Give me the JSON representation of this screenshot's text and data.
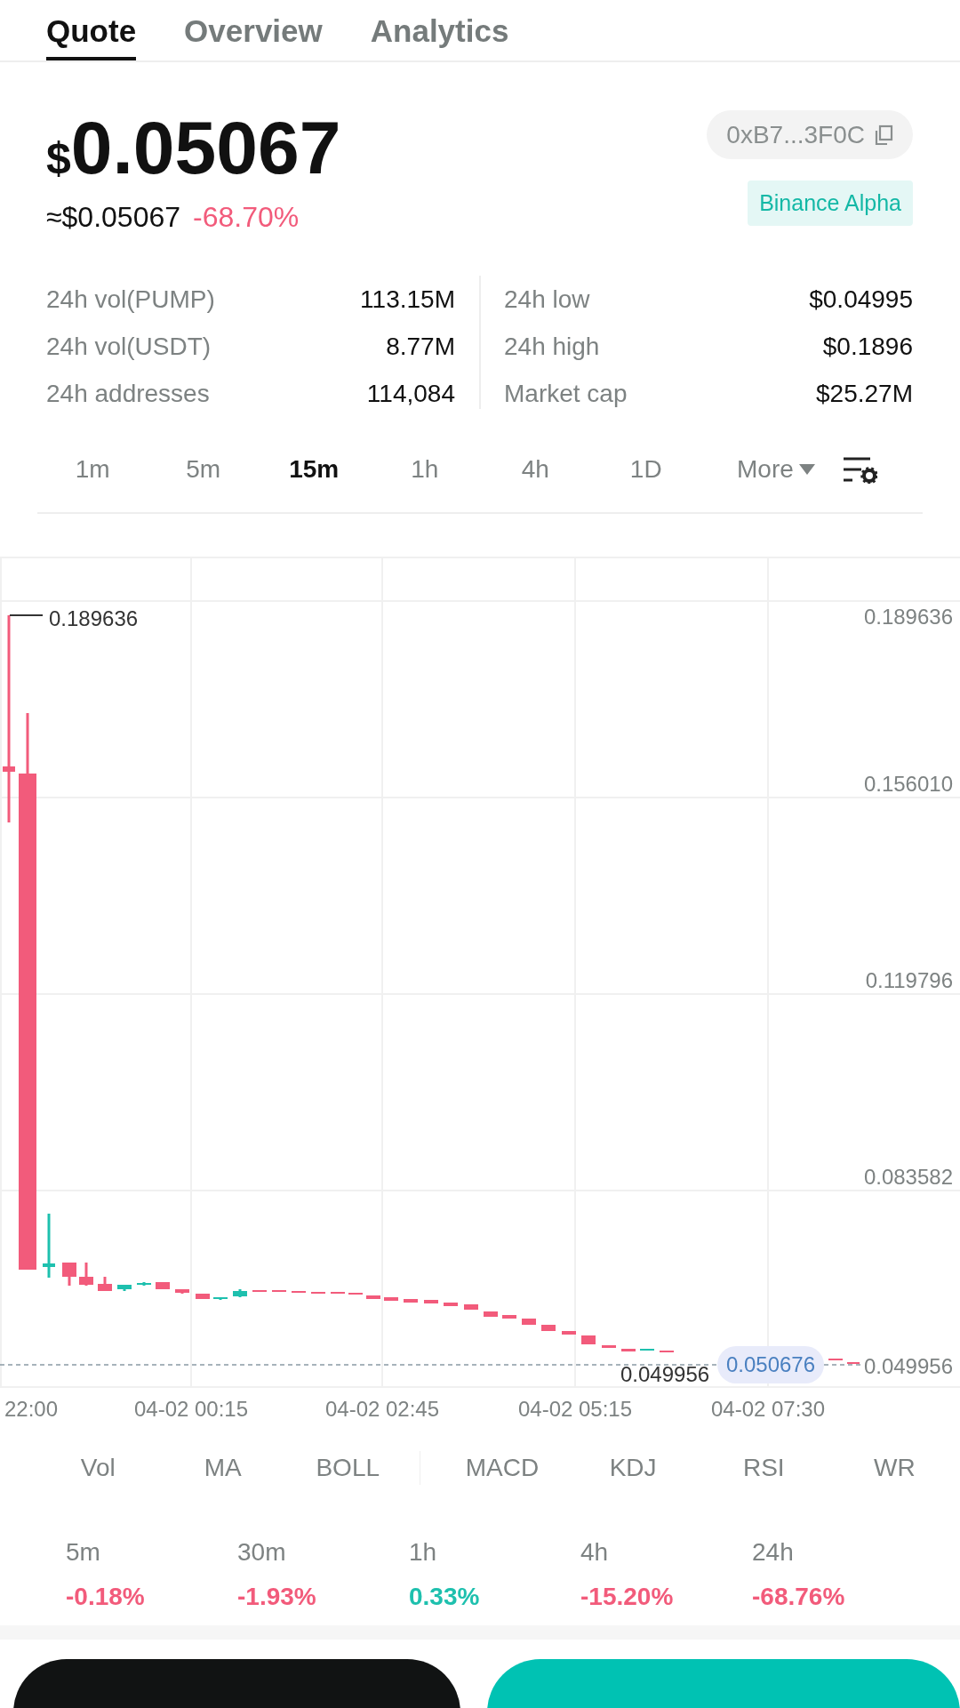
{
  "tabs": [
    {
      "label": "Quote",
      "selected": true
    },
    {
      "label": "Overview",
      "selected": false
    },
    {
      "label": "Analytics",
      "selected": false
    }
  ],
  "price": {
    "currency": "$",
    "value": "0.05067",
    "approx": "≈$0.05067",
    "change": "-68.70%",
    "color": "#f25b7b"
  },
  "contract": {
    "address": "0xB7...3F0C"
  },
  "badge": "Binance Alpha",
  "stats_left": [
    {
      "label": "24h vol(PUMP)",
      "value": "113.15M"
    },
    {
      "label": "24h vol(USDT)",
      "value": "8.77M"
    },
    {
      "label": "24h addresses",
      "value": "114,084"
    }
  ],
  "stats_right": [
    {
      "label": "24h low",
      "value": "$0.04995"
    },
    {
      "label": "24h high",
      "value": "$0.1896"
    },
    {
      "label": "Market cap",
      "value": "$25.27M"
    }
  ],
  "intervals": [
    {
      "label": "1m",
      "selected": false
    },
    {
      "label": "5m",
      "selected": false
    },
    {
      "label": "15m",
      "selected": true
    },
    {
      "label": "1h",
      "selected": false
    },
    {
      "label": "4h",
      "selected": false
    },
    {
      "label": "1D",
      "selected": false
    }
  ],
  "more": "More",
  "chart": {
    "y_labels": [
      "0.189636",
      "0.156010",
      "0.119796",
      "0.083582",
      "0.049956"
    ],
    "time_labels": [
      "22:00",
      "04-02 00:15",
      "04-02 02:45",
      "04-02 05:15",
      "04-02 07:30"
    ],
    "high_label": "0.189636",
    "low_label": "0.049956",
    "current_price": "0.050676"
  },
  "indicators_main": [
    "Vol",
    "MA",
    "BOLL"
  ],
  "indicators_sub": [
    "MACD",
    "KDJ",
    "RSI",
    "WR"
  ],
  "changes": [
    {
      "period": "5m",
      "value": "-0.18%",
      "color": "#f25b7b"
    },
    {
      "period": "30m",
      "value": "-1.93%",
      "color": "#f25b7b"
    },
    {
      "period": "1h",
      "value": "0.33%",
      "color": "#1ec0ae"
    },
    {
      "period": "4h",
      "value": "-15.20%",
      "color": "#f25b7b"
    },
    {
      "period": "24h",
      "value": "-68.76%",
      "color": "#f25b7b"
    }
  ],
  "action_buttons": [
    {
      "kind": "dark"
    },
    {
      "kind": "accent"
    }
  ]
}
